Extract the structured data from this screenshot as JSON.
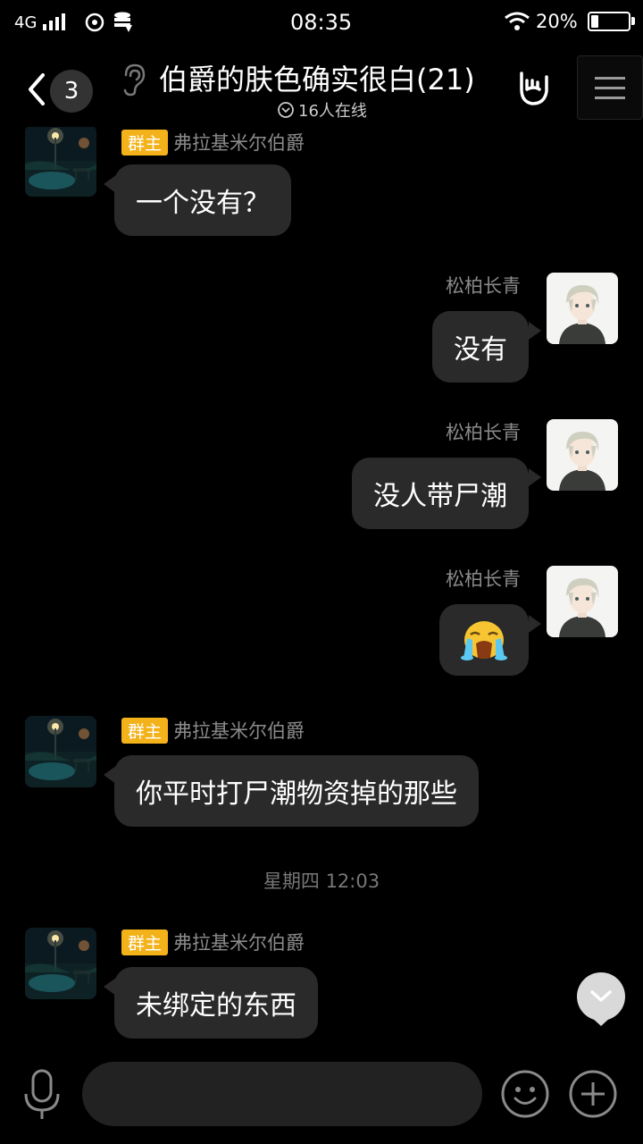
{
  "status_bar": {
    "network": "4G",
    "time": "08:35",
    "battery": "20%",
    "battery_level": 0.2
  },
  "header": {
    "unread_count": "3",
    "title": "伯爵的肤色确实很白(21)",
    "online": "16人在线"
  },
  "messages": [
    {
      "side": "left",
      "sender": "弗拉基米尔伯爵",
      "badge": "群主",
      "text": "一个没有？"
    },
    {
      "side": "right",
      "sender": "松柏长青",
      "text": "没有"
    },
    {
      "side": "right",
      "sender": "松柏长青",
      "text": "没人带尸潮"
    },
    {
      "side": "right",
      "sender": "松柏长青",
      "emoji": "crying-face"
    },
    {
      "side": "left",
      "sender": "弗拉基米尔伯爵",
      "badge": "群主",
      "text": "你平时打尸潮物资掉的那些"
    },
    {
      "side": "left",
      "sender": "弗拉基米尔伯爵",
      "badge": "群主",
      "text": "未绑定的东西"
    }
  ],
  "time_divider": "星期四 12:03",
  "input": {
    "placeholder": ""
  },
  "colors": {
    "background": "#000000",
    "bubble": "#2a2a2a",
    "owner_badge": "#f3b219"
  }
}
